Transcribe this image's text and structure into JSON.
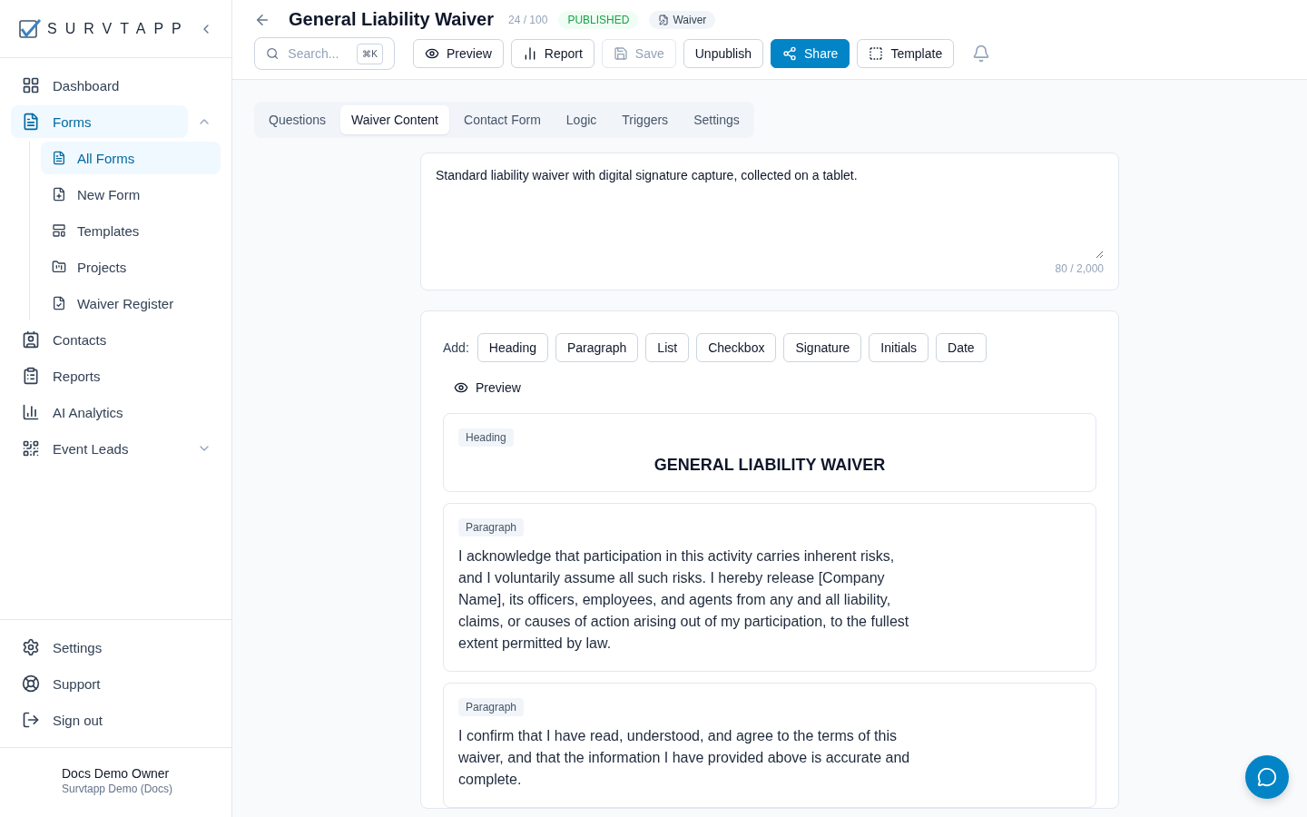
{
  "sidebar": {
    "logo": "SURVTAPP",
    "nav": [
      {
        "label": "Dashboard",
        "selected": false
      },
      {
        "label": "Forms",
        "selected": true,
        "expanded": true,
        "children": [
          {
            "label": "All Forms",
            "selected": true
          },
          {
            "label": "New Form",
            "selected": false
          },
          {
            "label": "Templates",
            "selected": false
          },
          {
            "label": "Projects",
            "selected": false
          },
          {
            "label": "Waiver Register",
            "selected": false
          }
        ]
      },
      {
        "label": "Contacts",
        "selected": false
      },
      {
        "label": "Reports",
        "selected": false
      },
      {
        "label": "AI Analytics",
        "selected": false
      },
      {
        "label": "Event Leads",
        "selected": false,
        "expanded": false
      }
    ],
    "footer": [
      {
        "label": "Settings"
      },
      {
        "label": "Support"
      },
      {
        "label": "Sign out"
      }
    ],
    "user": {
      "name": "Docs Demo Owner",
      "org": "Survtapp Demo (Docs)"
    }
  },
  "header": {
    "title": "General Liability Waiver",
    "count": "24 / 100",
    "status": "PUBLISHED",
    "type": "Waiver",
    "search": {
      "placeholder": "Search...",
      "shortcut": "⌘K"
    },
    "buttons": [
      {
        "label": "Preview",
        "kind": "preview",
        "disabled": false,
        "primary": false
      },
      {
        "label": "Report",
        "kind": "report",
        "disabled": false,
        "primary": false
      },
      {
        "label": "Save",
        "kind": "save",
        "disabled": true,
        "primary": false
      },
      {
        "label": "Unpublish",
        "kind": "plain",
        "disabled": false,
        "primary": false
      },
      {
        "label": "Share",
        "kind": "share",
        "disabled": false,
        "primary": true
      },
      {
        "label": "Template",
        "kind": "template",
        "disabled": false,
        "primary": false
      }
    ]
  },
  "tabs": [
    {
      "label": "Questions",
      "selected": false
    },
    {
      "label": "Waiver Content",
      "selected": true
    },
    {
      "label": "Contact Form",
      "selected": false
    },
    {
      "label": "Logic",
      "selected": false
    },
    {
      "label": "Triggers",
      "selected": false
    },
    {
      "label": "Settings",
      "selected": false
    }
  ],
  "description": {
    "value": "Standard liability waiver with digital signature capture, collected on a tablet.",
    "counter": "80 / 2,000"
  },
  "builder": {
    "add_label": "Add:",
    "add_buttons": [
      "Heading",
      "Paragraph",
      "List",
      "Checkbox",
      "Signature",
      "Initials",
      "Date"
    ],
    "preview": "Preview",
    "blocks": [
      {
        "kind": "heading",
        "tag": "Heading",
        "text": "GENERAL LIABILITY WAIVER"
      },
      {
        "kind": "paragraph",
        "tag": "Paragraph",
        "text": "I acknowledge that participation in this activity carries inherent risks, and I voluntarily assume all such risks. I hereby release [Company Name], its officers, employees, and agents from any and all liability, claims, or causes of action arising out of my participation, to the fullest extent permitted by law."
      },
      {
        "kind": "paragraph",
        "tag": "Paragraph",
        "text": "I confirm that I have read, understood, and agree to the terms of this waiver, and that the information I have provided above is accurate and complete."
      }
    ]
  }
}
